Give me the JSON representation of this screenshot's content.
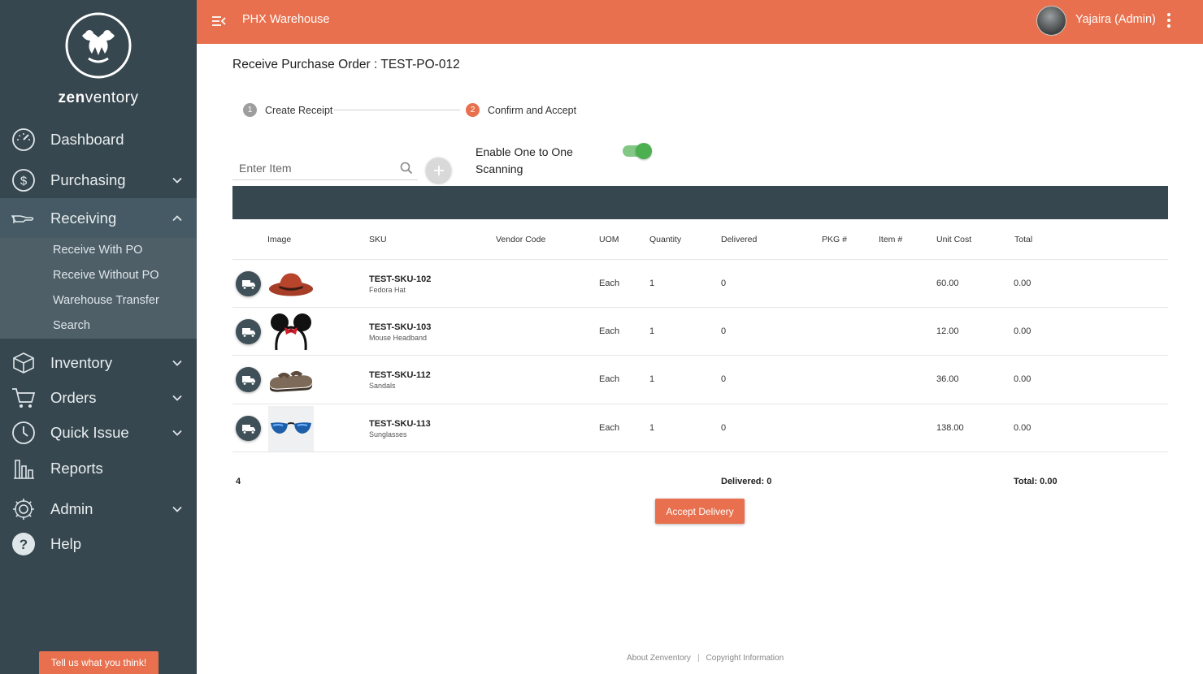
{
  "brand": {
    "name_prefix": "zen",
    "name_suffix": "ventory"
  },
  "sidebar": {
    "items": [
      {
        "label": "Dashboard",
        "icon": "dashboard-gauge-icon"
      },
      {
        "label": "Purchasing",
        "icon": "dollar-circle-icon"
      },
      {
        "label": "Receiving",
        "icon": "receiving-hand-icon"
      },
      {
        "label": "Inventory",
        "icon": "box-icon"
      },
      {
        "label": "Orders",
        "icon": "cart-icon"
      },
      {
        "label": "Quick Issue",
        "icon": "clock-icon"
      },
      {
        "label": "Reports",
        "icon": "bar-chart-icon"
      },
      {
        "label": "Admin",
        "icon": "gear-icon"
      },
      {
        "label": "Help",
        "icon": "help-icon"
      }
    ],
    "receiving_sub": [
      "Receive With PO",
      "Receive Without PO",
      "Warehouse Transfer",
      "Search"
    ],
    "feedback_label": "Tell us what you think!"
  },
  "topbar": {
    "warehouse": "PHX Warehouse",
    "user": "Yajaira (Admin)"
  },
  "page": {
    "title": "Receive Purchase Order : TEST-PO-012"
  },
  "steps": [
    {
      "num": "1",
      "label": "Create Receipt"
    },
    {
      "num": "2",
      "label": "Confirm and Accept"
    }
  ],
  "search": {
    "placeholder": "Enter Item"
  },
  "scanning": {
    "label": "Enable One to One Scanning",
    "enabled": true
  },
  "table": {
    "headers": [
      "Image",
      "SKU",
      "Vendor Code",
      "UOM",
      "Quantity",
      "Delivered",
      "PKG #",
      "Item #",
      "Unit Cost",
      "Total"
    ],
    "rows": [
      {
        "sku": "TEST-SKU-102",
        "name": "Fedora Hat",
        "vendor_code": "",
        "uom": "Each",
        "quantity": "1",
        "delivered": "0",
        "pkg": "",
        "item": "",
        "unit_cost": "60.00",
        "total": "0.00"
      },
      {
        "sku": "TEST-SKU-103",
        "name": "Mouse Headband",
        "vendor_code": "",
        "uom": "Each",
        "quantity": "1",
        "delivered": "0",
        "pkg": "",
        "item": "",
        "unit_cost": "12.00",
        "total": "0.00"
      },
      {
        "sku": "TEST-SKU-112",
        "name": "Sandals",
        "vendor_code": "",
        "uom": "Each",
        "quantity": "1",
        "delivered": "0",
        "pkg": "",
        "item": "",
        "unit_cost": "36.00",
        "total": "0.00"
      },
      {
        "sku": "TEST-SKU-113",
        "name": "Sunglasses",
        "vendor_code": "",
        "uom": "Each",
        "quantity": "1",
        "delivered": "0",
        "pkg": "",
        "item": "",
        "unit_cost": "138.00",
        "total": "0.00"
      }
    ],
    "footer": {
      "count": "4",
      "delivered": "Delivered: 0",
      "total": "Total: 0.00"
    }
  },
  "accept_label": "Accept Delivery",
  "footer": {
    "about": "About Zenventory",
    "separator": "|",
    "copyright": "Copyright Information"
  },
  "colors": {
    "accent": "#e8704e",
    "sidebar": "#37474f",
    "toggle_on": "#4caf50"
  }
}
